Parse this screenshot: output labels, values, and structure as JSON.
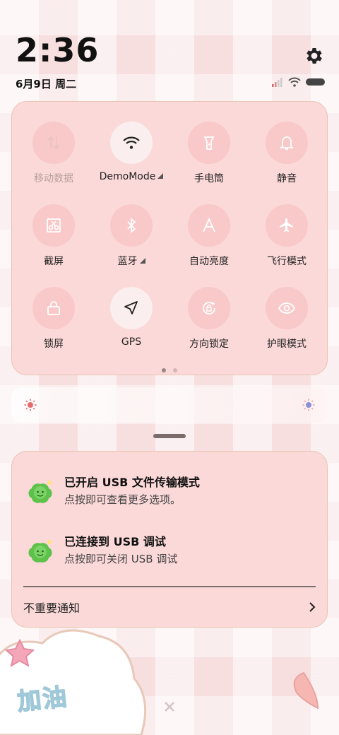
{
  "status_bar": {
    "time": "2:36",
    "date": "6月9日 周二",
    "icons": [
      "signal-icon",
      "wifi-icon",
      "battery-icon"
    ]
  },
  "quick_settings": {
    "tiles": [
      {
        "label": "移动数据",
        "icon": "mobile-data-icon",
        "state": "disabled"
      },
      {
        "label": "DemoMode",
        "icon": "wifi-icon",
        "state": "active",
        "expandable": true
      },
      {
        "label": "手电筒",
        "icon": "flashlight-icon",
        "state": "off"
      },
      {
        "label": "静音",
        "icon": "bell-icon",
        "state": "off"
      },
      {
        "label": "截屏",
        "icon": "screenshot-icon",
        "state": "off"
      },
      {
        "label": "蓝牙",
        "icon": "bluetooth-icon",
        "state": "off",
        "expandable": true
      },
      {
        "label": "自动亮度",
        "icon": "auto-brightness-icon",
        "state": "off"
      },
      {
        "label": "飞行模式",
        "icon": "airplane-icon",
        "state": "off"
      },
      {
        "label": "锁屏",
        "icon": "lock-icon",
        "state": "off"
      },
      {
        "label": "GPS",
        "icon": "location-arrow-icon",
        "state": "active"
      },
      {
        "label": "方向锁定",
        "icon": "rotation-lock-icon",
        "state": "off"
      },
      {
        "label": "护眼模式",
        "icon": "eye-icon",
        "state": "off"
      }
    ],
    "page_count": 2,
    "current_page": 1
  },
  "brightness": {
    "icons": [
      "brightness-low-icon",
      "brightness-high-icon"
    ]
  },
  "notifications": {
    "items": [
      {
        "title": "已开启 USB 文件传输模式",
        "subtitle": "点按即可查看更多选项。"
      },
      {
        "title": "已连接到 USB 调试",
        "subtitle": "点按即可关闭 USB 调试"
      }
    ],
    "minor_label": "不重要通知"
  },
  "wallpaper": {
    "text": "加油"
  },
  "colors": {
    "panel": "#fbd9d8",
    "tile": "#f8c9c8",
    "tile_active": "#fbeeee",
    "accent_green": "#5cc24a"
  }
}
